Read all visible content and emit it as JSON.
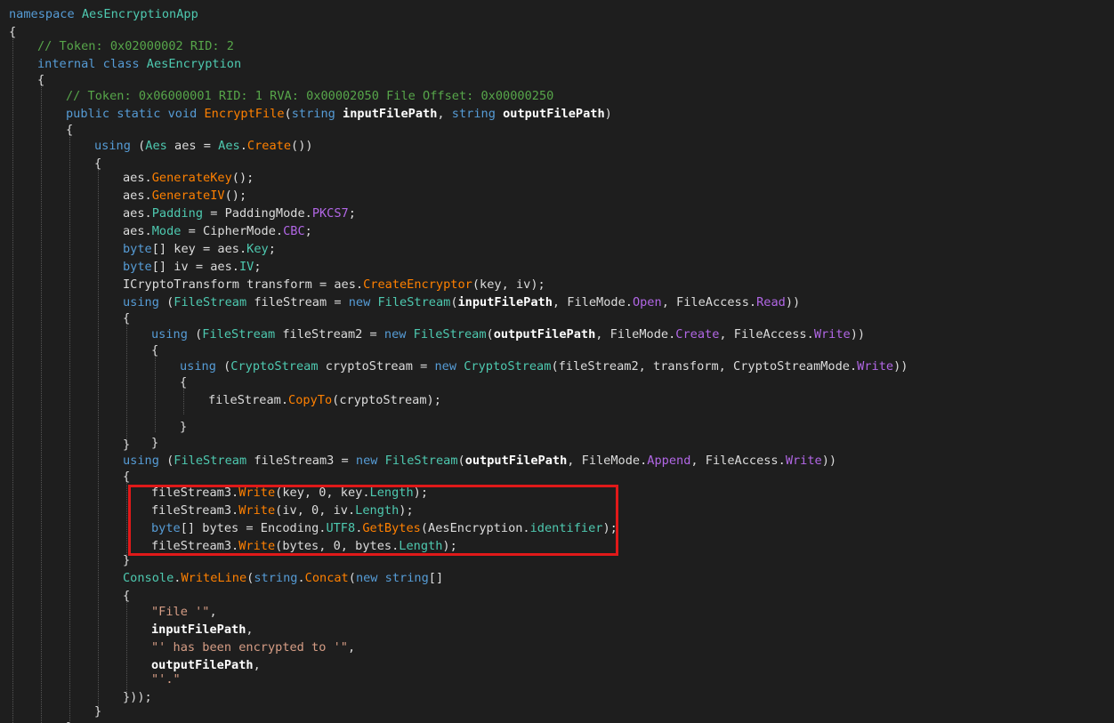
{
  "colors": {
    "background": "#1e1e1e",
    "keyword": "#569cd6",
    "type": "#4ec9b0",
    "method": "#ff8000",
    "comment": "#57a64a",
    "string": "#d69d85",
    "enum_value": "#b267e6",
    "highlight_box": "#e01919"
  },
  "code_lines": [
    {
      "indent": 0,
      "tokens": [
        [
          "keyword",
          "namespace "
        ],
        [
          "type",
          "AesEncryptionApp"
        ]
      ]
    },
    {
      "indent": 0,
      "tokens": [
        [
          "plain",
          "{"
        ]
      ]
    },
    {
      "indent": 1,
      "tokens": [
        [
          "comment",
          "// Token: 0x02000002 RID: 2"
        ]
      ]
    },
    {
      "indent": 1,
      "tokens": [
        [
          "keyword",
          "internal class "
        ],
        [
          "type",
          "AesEncryption"
        ]
      ]
    },
    {
      "indent": 1,
      "tokens": [
        [
          "plain",
          "{"
        ]
      ]
    },
    {
      "indent": 2,
      "tokens": [
        [
          "comment",
          "// Token: 0x06000001 RID: 1 RVA: 0x00002050 File Offset: 0x00000250"
        ]
      ]
    },
    {
      "indent": 2,
      "tokens": [
        [
          "keyword",
          "public static void "
        ],
        [
          "method",
          "EncryptFile"
        ],
        [
          "plain",
          "("
        ],
        [
          "keyword",
          "string "
        ],
        [
          "param",
          "inputFilePath"
        ],
        [
          "plain",
          ", "
        ],
        [
          "keyword",
          "string "
        ],
        [
          "param",
          "outputFilePath"
        ],
        [
          "plain",
          ")"
        ]
      ]
    },
    {
      "indent": 2,
      "tokens": [
        [
          "plain",
          "{"
        ]
      ]
    },
    {
      "indent": 3,
      "tokens": [
        [
          "keyword",
          "using "
        ],
        [
          "plain",
          "("
        ],
        [
          "type",
          "Aes"
        ],
        [
          "plain",
          " aes = "
        ],
        [
          "type",
          "Aes"
        ],
        [
          "plain",
          "."
        ],
        [
          "method",
          "Create"
        ],
        [
          "plain",
          "())"
        ]
      ]
    },
    {
      "indent": 3,
      "tokens": [
        [
          "plain",
          "{"
        ]
      ]
    },
    {
      "indent": 4,
      "tokens": [
        [
          "plain",
          "aes."
        ],
        [
          "method",
          "GenerateKey"
        ],
        [
          "plain",
          "();"
        ]
      ]
    },
    {
      "indent": 4,
      "tokens": [
        [
          "plain",
          "aes."
        ],
        [
          "method",
          "GenerateIV"
        ],
        [
          "plain",
          "();"
        ]
      ]
    },
    {
      "indent": 4,
      "tokens": [
        [
          "plain",
          "aes."
        ],
        [
          "prop",
          "Padding"
        ],
        [
          "plain",
          " = PaddingMode."
        ],
        [
          "enumval",
          "PKCS7"
        ],
        [
          "plain",
          ";"
        ]
      ]
    },
    {
      "indent": 4,
      "tokens": [
        [
          "plain",
          "aes."
        ],
        [
          "prop",
          "Mode"
        ],
        [
          "plain",
          " = CipherMode."
        ],
        [
          "enumval",
          "CBC"
        ],
        [
          "plain",
          ";"
        ]
      ]
    },
    {
      "indent": 4,
      "tokens": [
        [
          "keyword",
          "byte"
        ],
        [
          "plain",
          "[] key = aes."
        ],
        [
          "prop",
          "Key"
        ],
        [
          "plain",
          ";"
        ]
      ]
    },
    {
      "indent": 4,
      "tokens": [
        [
          "keyword",
          "byte"
        ],
        [
          "plain",
          "[] iv = aes."
        ],
        [
          "prop",
          "IV"
        ],
        [
          "plain",
          ";"
        ]
      ]
    },
    {
      "indent": 4,
      "tokens": [
        [
          "plain",
          "ICryptoTransform transform = aes."
        ],
        [
          "method",
          "CreateEncryptor"
        ],
        [
          "plain",
          "(key, iv);"
        ]
      ]
    },
    {
      "indent": 4,
      "tokens": [
        [
          "keyword",
          "using "
        ],
        [
          "plain",
          "("
        ],
        [
          "type",
          "FileStream"
        ],
        [
          "plain",
          " fileStream = "
        ],
        [
          "keyword",
          "new "
        ],
        [
          "type",
          "FileStream"
        ],
        [
          "plain",
          "("
        ],
        [
          "param",
          "inputFilePath"
        ],
        [
          "plain",
          ", FileMode."
        ],
        [
          "enumval",
          "Open"
        ],
        [
          "plain",
          ", FileAccess."
        ],
        [
          "enumval",
          "Read"
        ],
        [
          "plain",
          "))"
        ]
      ]
    },
    {
      "indent": 4,
      "tokens": [
        [
          "plain",
          "{"
        ]
      ]
    },
    {
      "indent": 5,
      "tokens": [
        [
          "keyword",
          "using "
        ],
        [
          "plain",
          "("
        ],
        [
          "type",
          "FileStream"
        ],
        [
          "plain",
          " fileStream2 = "
        ],
        [
          "keyword",
          "new "
        ],
        [
          "type",
          "FileStream"
        ],
        [
          "plain",
          "("
        ],
        [
          "param",
          "outputFilePath"
        ],
        [
          "plain",
          ", FileMode."
        ],
        [
          "enumval",
          "Create"
        ],
        [
          "plain",
          ", FileAccess."
        ],
        [
          "enumval",
          "Write"
        ],
        [
          "plain",
          "))"
        ]
      ]
    },
    {
      "indent": 5,
      "tokens": [
        [
          "plain",
          "{"
        ]
      ]
    },
    {
      "indent": 6,
      "tokens": [
        [
          "keyword",
          "using "
        ],
        [
          "plain",
          "("
        ],
        [
          "type",
          "CryptoStream"
        ],
        [
          "plain",
          " cryptoStream = "
        ],
        [
          "keyword",
          "new "
        ],
        [
          "type",
          "CryptoStream"
        ],
        [
          "plain",
          "(fileStream2, transform, CryptoStreamMode."
        ],
        [
          "enumval",
          "Write"
        ],
        [
          "plain",
          "))"
        ]
      ]
    },
    {
      "indent": 6,
      "tokens": [
        [
          "plain",
          "{"
        ]
      ]
    },
    {
      "indent": 7,
      "tokens": [
        [
          "plain",
          "fileStream."
        ],
        [
          "method",
          "CopyTo"
        ],
        [
          "plain",
          "(cryptoStream);"
        ]
      ]
    },
    {
      "indent": 6,
      "tokens": [
        [
          "plain",
          "}"
        ]
      ]
    },
    {
      "indent": 5,
      "tokens": [
        [
          "plain",
          "}"
        ]
      ]
    },
    {
      "indent": 4,
      "tokens": [
        [
          "plain",
          "}"
        ]
      ]
    },
    {
      "indent": 4,
      "tokens": [
        [
          "keyword",
          "using "
        ],
        [
          "plain",
          "("
        ],
        [
          "type",
          "FileStream"
        ],
        [
          "plain",
          " fileStream3 = "
        ],
        [
          "keyword",
          "new "
        ],
        [
          "type",
          "FileStream"
        ],
        [
          "plain",
          "("
        ],
        [
          "param",
          "outputFilePath"
        ],
        [
          "plain",
          ", FileMode."
        ],
        [
          "enumval",
          "Append"
        ],
        [
          "plain",
          ", FileAccess."
        ],
        [
          "enumval",
          "Write"
        ],
        [
          "plain",
          "))"
        ]
      ]
    },
    {
      "indent": 4,
      "tokens": [
        [
          "plain",
          "{"
        ]
      ]
    },
    {
      "indent": 5,
      "tokens": [
        [
          "plain",
          "fileStream3."
        ],
        [
          "method",
          "Write"
        ],
        [
          "plain",
          "(key, 0, key."
        ],
        [
          "prop",
          "Length"
        ],
        [
          "plain",
          ");"
        ]
      ]
    },
    {
      "indent": 5,
      "tokens": [
        [
          "plain",
          "fileStream3."
        ],
        [
          "method",
          "Write"
        ],
        [
          "plain",
          "(iv, 0, iv."
        ],
        [
          "prop",
          "Length"
        ],
        [
          "plain",
          ");"
        ]
      ]
    },
    {
      "indent": 5,
      "tokens": [
        [
          "keyword",
          "byte"
        ],
        [
          "plain",
          "[] bytes = Encoding."
        ],
        [
          "prop",
          "UTF8"
        ],
        [
          "plain",
          "."
        ],
        [
          "method",
          "GetBytes"
        ],
        [
          "plain",
          "(AesEncryption."
        ],
        [
          "prop",
          "identifier"
        ],
        [
          "plain",
          ");"
        ]
      ]
    },
    {
      "indent": 5,
      "tokens": [
        [
          "plain",
          "fileStream3."
        ],
        [
          "method",
          "Write"
        ],
        [
          "plain",
          "(bytes, 0, bytes."
        ],
        [
          "prop",
          "Length"
        ],
        [
          "plain",
          ");"
        ]
      ]
    },
    {
      "indent": 4,
      "tokens": [
        [
          "plain",
          "}"
        ]
      ]
    },
    {
      "indent": 4,
      "tokens": [
        [
          "type",
          "Console"
        ],
        [
          "plain",
          "."
        ],
        [
          "method",
          "WriteLine"
        ],
        [
          "plain",
          "("
        ],
        [
          "keyword",
          "string"
        ],
        [
          "plain",
          "."
        ],
        [
          "method",
          "Concat"
        ],
        [
          "plain",
          "("
        ],
        [
          "keyword",
          "new string"
        ],
        [
          "plain",
          "[]"
        ]
      ]
    },
    {
      "indent": 4,
      "tokens": [
        [
          "plain",
          "{"
        ]
      ]
    },
    {
      "indent": 5,
      "tokens": [
        [
          "string",
          "\"File '\""
        ],
        [
          "plain",
          ","
        ]
      ]
    },
    {
      "indent": 5,
      "tokens": [
        [
          "param",
          "inputFilePath"
        ],
        [
          "plain",
          ","
        ]
      ]
    },
    {
      "indent": 5,
      "tokens": [
        [
          "string",
          "\"' has been encrypted to '\""
        ],
        [
          "plain",
          ","
        ]
      ]
    },
    {
      "indent": 5,
      "tokens": [
        [
          "param",
          "outputFilePath"
        ],
        [
          "plain",
          ","
        ]
      ]
    },
    {
      "indent": 5,
      "tokens": [
        [
          "string",
          "\"'.\""
        ]
      ]
    },
    {
      "indent": 4,
      "tokens": [
        [
          "plain",
          "}));"
        ]
      ]
    },
    {
      "indent": 3,
      "tokens": [
        [
          "plain",
          "}"
        ]
      ]
    },
    {
      "indent": 2,
      "tokens": [
        [
          "plain",
          "}"
        ]
      ]
    }
  ]
}
